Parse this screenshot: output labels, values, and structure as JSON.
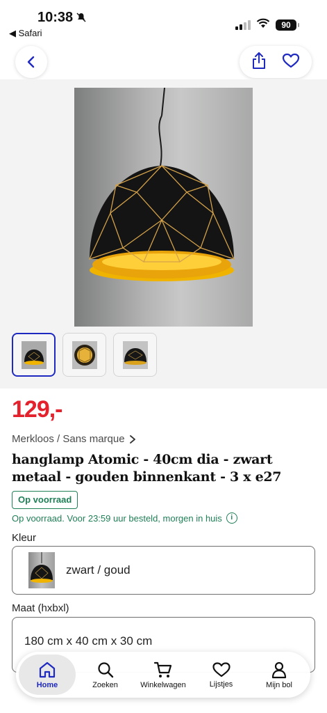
{
  "status_bar": {
    "time": "10:38",
    "back_app": "◀ Safari",
    "battery": "90"
  },
  "product": {
    "price": "129,-",
    "brand": "Merkloos / Sans marque",
    "title": "hanglamp Atomic - 40cm dia - zwart metaal - gouden binnenkant - 3 x e27",
    "stock_badge": "Op voorraad",
    "delivery": "Op voorraad. Voor 23:59 uur besteld, morgen in huis"
  },
  "options": {
    "color_label": "Kleur",
    "color_value": "zwart / goud",
    "size_label": "Maat (hxbxl)",
    "size_value": "180 cm x 40 cm x 30 cm"
  },
  "tabbar": {
    "items": [
      {
        "label": "Home",
        "icon": "home-icon"
      },
      {
        "label": "Zoeken",
        "icon": "search-icon"
      },
      {
        "label": "Winkelwagen",
        "icon": "cart-icon"
      },
      {
        "label": "Lijstjes",
        "icon": "heart-icon"
      },
      {
        "label": "Mijn bol",
        "icon": "user-icon"
      }
    ]
  },
  "colors": {
    "price": "#e4222d",
    "accent": "#1e29c0",
    "stock": "#1f7f56"
  }
}
